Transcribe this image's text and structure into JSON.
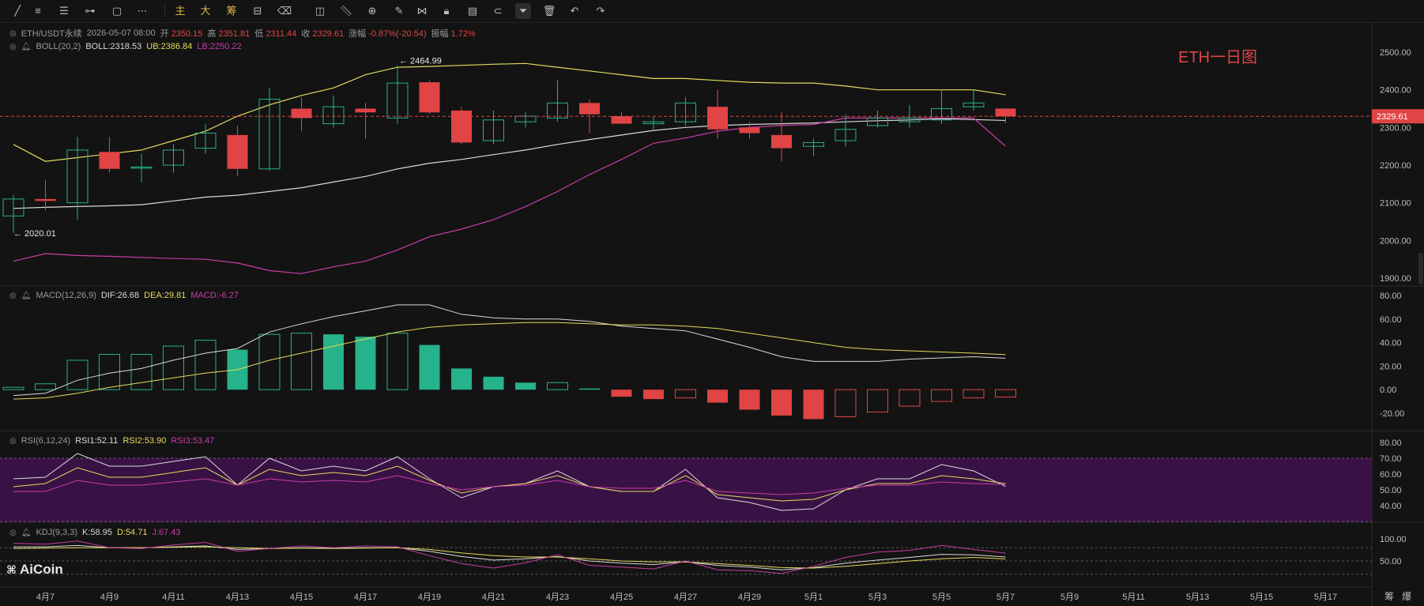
{
  "toolbar": {
    "tools": [
      "trend-line-icon",
      "horizontal-line-icon",
      "parallel-lines-icon",
      "fib-icon",
      "rectangle-icon",
      "dots-menu-icon"
    ],
    "text_buttons": [
      "主",
      "大",
      "筹"
    ],
    "tools2": [
      "hide-indicators-icon",
      "eraser-icon",
      "crop-icon",
      "ruler-icon",
      "zoom-icon",
      "edit-icon",
      "pattern-icon",
      "lock-icon",
      "note-icon",
      "magnet-icon",
      "filter-icon",
      "trash-icon",
      "undo-icon",
      "redo-icon"
    ]
  },
  "legend": {
    "symbol": "ETH/USDT永续",
    "datetime": "2026-05-07 08:00",
    "open_label": "开",
    "open": "2350.15",
    "high_label": "高",
    "high": "2351.81",
    "low_label": "低",
    "low": "2311.44",
    "close_label": "收",
    "close": "2329.61",
    "change_label": "涨幅",
    "change": "-0.87%(-20.54)",
    "amp_label": "振幅",
    "amp": "1.72%",
    "boll_name": "BOLL(20,2)",
    "boll": "BOLL:2318.53",
    "ub": "UB:2386.84",
    "lb": "LB:2250.22",
    "macd_name": "MACD(12,26,9)",
    "dif": "DIF:26.68",
    "dea": "DEA:29.81",
    "macd": "MACD:-6.27",
    "rsi_name": "RSI(6,12,24)",
    "rsi1": "RSI1:52.11",
    "rsi2": "RSI2:53.90",
    "rsi3": "RSI3:53.47",
    "kdj_name": "KDJ(9,3,3)",
    "k": "K:58.95",
    "d": "D:54.71",
    "j": "J:67.43"
  },
  "annotation_title": "ETH一日图",
  "watermark": "AiCoin",
  "bottom_right": [
    "筹",
    "爆"
  ],
  "colors": {
    "up": "#26b28a",
    "down": "#e04444",
    "boll_mid": "#d9d9d9",
    "boll_ub": "#e3db5d",
    "boll_lb": "#c93da8",
    "accent": "#e04444",
    "rsi_band": "#3b1248"
  },
  "chart_data": [
    {
      "type": "candlestick",
      "title": "ETH一日图",
      "xlabel": "",
      "ylabel": "",
      "ylim": [
        1850,
        2560
      ],
      "yticks": [
        1900,
        2000,
        2100,
        2200,
        2300,
        2400,
        2500
      ],
      "x_ticks": [
        "4月7",
        "4月9",
        "4月11",
        "4月13",
        "4月15",
        "4月17",
        "4月19",
        "4月21",
        "4月23",
        "4月25",
        "4月27",
        "4月29",
        "5月1",
        "5月3",
        "5月5",
        "5月7",
        "5月9",
        "5月11",
        "5月13",
        "5月15",
        "5月17"
      ],
      "dates": [
        "4月6",
        "4月7",
        "4月8",
        "4月9",
        "4月10",
        "4月11",
        "4月12",
        "4月13",
        "4月14",
        "4月15",
        "4月16",
        "4月17",
        "4月18",
        "4月19",
        "4月20",
        "4月21",
        "4月22",
        "4月23",
        "4月24",
        "4月25",
        "4月26",
        "4月27",
        "4月28",
        "4月29",
        "4月30",
        "5月1",
        "5月2",
        "5月3",
        "5月4",
        "5月5",
        "5月6",
        "5月7"
      ],
      "ohlc": [
        [
          2065,
          2120,
          2020.01,
          2110
        ],
        [
          2110,
          2160,
          2080,
          2105
        ],
        [
          2100,
          2275,
          2055,
          2240
        ],
        [
          2235,
          2275,
          2180,
          2190
        ],
        [
          2195,
          2230,
          2155,
          2195
        ],
        [
          2200,
          2255,
          2180,
          2240
        ],
        [
          2245,
          2310,
          2230,
          2285
        ],
        [
          2280,
          2305,
          2170,
          2190
        ],
        [
          2190,
          2405,
          2185,
          2375
        ],
        [
          2350,
          2380,
          2290,
          2325
        ],
        [
          2310,
          2385,
          2300,
          2355
        ],
        [
          2350,
          2365,
          2270,
          2340
        ],
        [
          2325,
          2465,
          2310,
          2418
        ],
        [
          2420,
          2425,
          2335,
          2340
        ],
        [
          2345,
          2355,
          2255,
          2260
        ],
        [
          2265,
          2345,
          2255,
          2320
        ],
        [
          2315,
          2340,
          2300,
          2330
        ],
        [
          2325,
          2425,
          2315,
          2365
        ],
        [
          2365,
          2375,
          2285,
          2335
        ],
        [
          2330,
          2340,
          2310,
          2310
        ],
        [
          2310,
          2330,
          2295,
          2315
        ],
        [
          2315,
          2380,
          2305,
          2365
        ],
        [
          2355,
          2400,
          2270,
          2295
        ],
        [
          2300,
          2315,
          2270,
          2285
        ],
        [
          2280,
          2340,
          2210,
          2245
        ],
        [
          2250,
          2270,
          2225,
          2260
        ],
        [
          2265,
          2335,
          2250,
          2295
        ],
        [
          2305,
          2345,
          2300,
          2325
        ],
        [
          2315,
          2360,
          2300,
          2325
        ],
        [
          2320,
          2400,
          2310,
          2350
        ],
        [
          2355,
          2400,
          2345,
          2365
        ],
        [
          2350.15,
          2351.81,
          2311.44,
          2329.61
        ]
      ],
      "boll_ub": [
        2255,
        2210,
        2220,
        2230,
        2240,
        2265,
        2290,
        2330,
        2360,
        2385,
        2405,
        2440,
        2460,
        2462,
        2465,
        2468,
        2470,
        2460,
        2450,
        2440,
        2430,
        2430,
        2425,
        2420,
        2418,
        2418,
        2410,
        2400,
        2400,
        2400,
        2400,
        2386.84
      ],
      "boll_mid": [
        2085,
        2088,
        2090,
        2092,
        2095,
        2105,
        2115,
        2120,
        2130,
        2140,
        2155,
        2170,
        2190,
        2205,
        2215,
        2228,
        2240,
        2255,
        2268,
        2280,
        2292,
        2300,
        2305,
        2308,
        2310,
        2312,
        2315,
        2318,
        2320,
        2323,
        2321,
        2318.53
      ],
      "boll_lb": [
        1945,
        1965,
        1960,
        1958,
        1955,
        1952,
        1950,
        1940,
        1920,
        1912,
        1930,
        1945,
        1975,
        2010,
        2030,
        2055,
        2090,
        2130,
        2175,
        2215,
        2258,
        2272,
        2290,
        2300,
        2305,
        2308,
        2325,
        2325,
        2325,
        2325,
        2325,
        2250.22
      ],
      "annotations": [
        {
          "label": "2464.99",
          "value": 2464.99
        },
        {
          "label": "2020.01",
          "value": 2020.01
        }
      ],
      "last_price_label": "2329.61"
    },
    {
      "type": "bar",
      "title": "MACD(12,26,9)",
      "ylim": [
        -30,
        85
      ],
      "yticks": [
        -20,
        0,
        20,
        40,
        60,
        80
      ],
      "macd": [
        2,
        5,
        25,
        30,
        30,
        37,
        42,
        34,
        47,
        48,
        47,
        45,
        48,
        38,
        18,
        11,
        6,
        6,
        1,
        -6,
        -8,
        -7,
        -11,
        -17,
        -22,
        -25,
        -23,
        -19,
        -14,
        -10,
        -7,
        -6.27
      ],
      "dif": [
        -5,
        -3,
        8,
        14,
        18,
        25,
        31,
        35,
        49,
        56,
        62,
        67,
        72,
        72,
        64,
        61,
        60,
        60,
        58,
        54,
        52,
        50,
        43,
        36,
        28,
        24,
        24,
        24,
        26,
        27,
        28,
        26.68
      ],
      "dea": [
        -8,
        -7,
        -3,
        2,
        6,
        10,
        14,
        17,
        25,
        31,
        37,
        43,
        49,
        53,
        55,
        56,
        57,
        57,
        56,
        55,
        55,
        54,
        52,
        48,
        44,
        40,
        36,
        34,
        33,
        32,
        31,
        29.81
      ]
    },
    {
      "type": "line",
      "title": "RSI(6,12,24)",
      "ylim": [
        25,
        85
      ],
      "yticks": [
        40,
        50,
        60,
        70,
        80
      ],
      "band": [
        30,
        70
      ],
      "rsi1": [
        57,
        58,
        73,
        65,
        65,
        68,
        71,
        53,
        70,
        62,
        65,
        62,
        71,
        57,
        45,
        52,
        54,
        62,
        52,
        49,
        49,
        63,
        45,
        42,
        37,
        38,
        50,
        57,
        57,
        66,
        62,
        52.11
      ],
      "rsi2": [
        52,
        54,
        64,
        58,
        58,
        61,
        64,
        53,
        63,
        59,
        61,
        59,
        65,
        56,
        48,
        52,
        54,
        59,
        52,
        49,
        49,
        59,
        47,
        45,
        43,
        44,
        50,
        54,
        54,
        59,
        57,
        53.9
      ],
      "rsi3": [
        49,
        49,
        56,
        53,
        53,
        55,
        57,
        53,
        57,
        55,
        56,
        55,
        59,
        54,
        50,
        52,
        53,
        56,
        52,
        51,
        51,
        56,
        49,
        48,
        47,
        48,
        51,
        53,
        53,
        55,
        54,
        53.47
      ]
    },
    {
      "type": "line",
      "title": "KDJ(9,3,3)",
      "ylim": [
        15,
        110
      ],
      "yticks": [
        50,
        100
      ],
      "k": [
        82,
        82,
        85,
        80,
        80,
        82,
        84,
        76,
        78,
        80,
        79,
        80,
        80,
        72,
        60,
        52,
        55,
        60,
        50,
        45,
        42,
        48,
        40,
        36,
        30,
        35,
        45,
        52,
        58,
        65,
        64,
        58.95
      ],
      "d": [
        78,
        79,
        80,
        80,
        80,
        81,
        82,
        80,
        78,
        79,
        78,
        79,
        80,
        76,
        68,
        62,
        59,
        59,
        55,
        50,
        48,
        48,
        44,
        40,
        35,
        34,
        38,
        44,
        50,
        55,
        58,
        54.71
      ],
      "j": [
        90,
        88,
        95,
        80,
        78,
        86,
        92,
        72,
        78,
        84,
        80,
        84,
        82,
        62,
        44,
        34,
        46,
        64,
        40,
        36,
        32,
        50,
        30,
        28,
        22,
        38,
        58,
        70,
        74,
        85,
        76,
        67.43
      ]
    }
  ]
}
